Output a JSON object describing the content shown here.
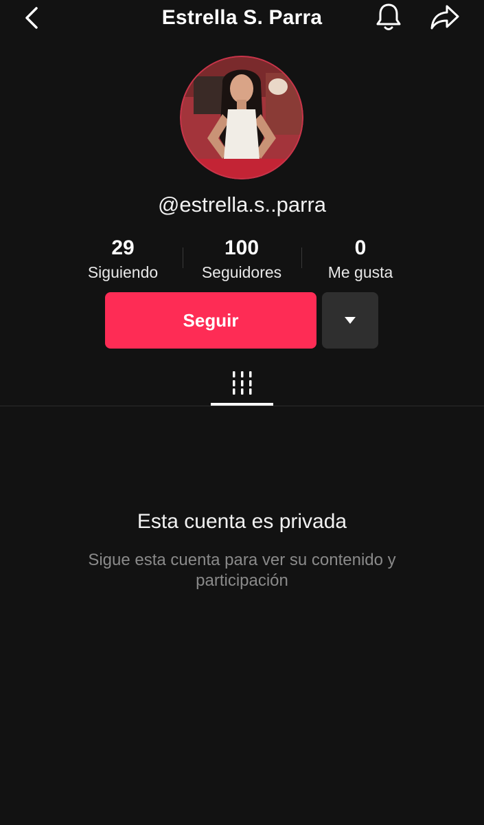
{
  "header": {
    "title": "Estrella S. Parra",
    "back_icon": "chevron-left-icon",
    "bell_icon": "bell-icon",
    "share_icon": "share-arrow-icon"
  },
  "profile": {
    "username": "@estrella.s..parra",
    "stats": [
      {
        "value": "29",
        "label": "Siguiendo"
      },
      {
        "value": "100",
        "label": "Seguidores"
      },
      {
        "value": "0",
        "label": "Me gusta"
      }
    ]
  },
  "actions": {
    "follow_label": "Seguir",
    "follow_color": "#fe2c55",
    "more_icon": "caret-down-icon"
  },
  "tabs": {
    "active_icon": "grid-icon"
  },
  "private_notice": {
    "title": "Esta cuenta es privada",
    "subtitle": "Sigue esta cuenta para ver su contenido y participación"
  }
}
